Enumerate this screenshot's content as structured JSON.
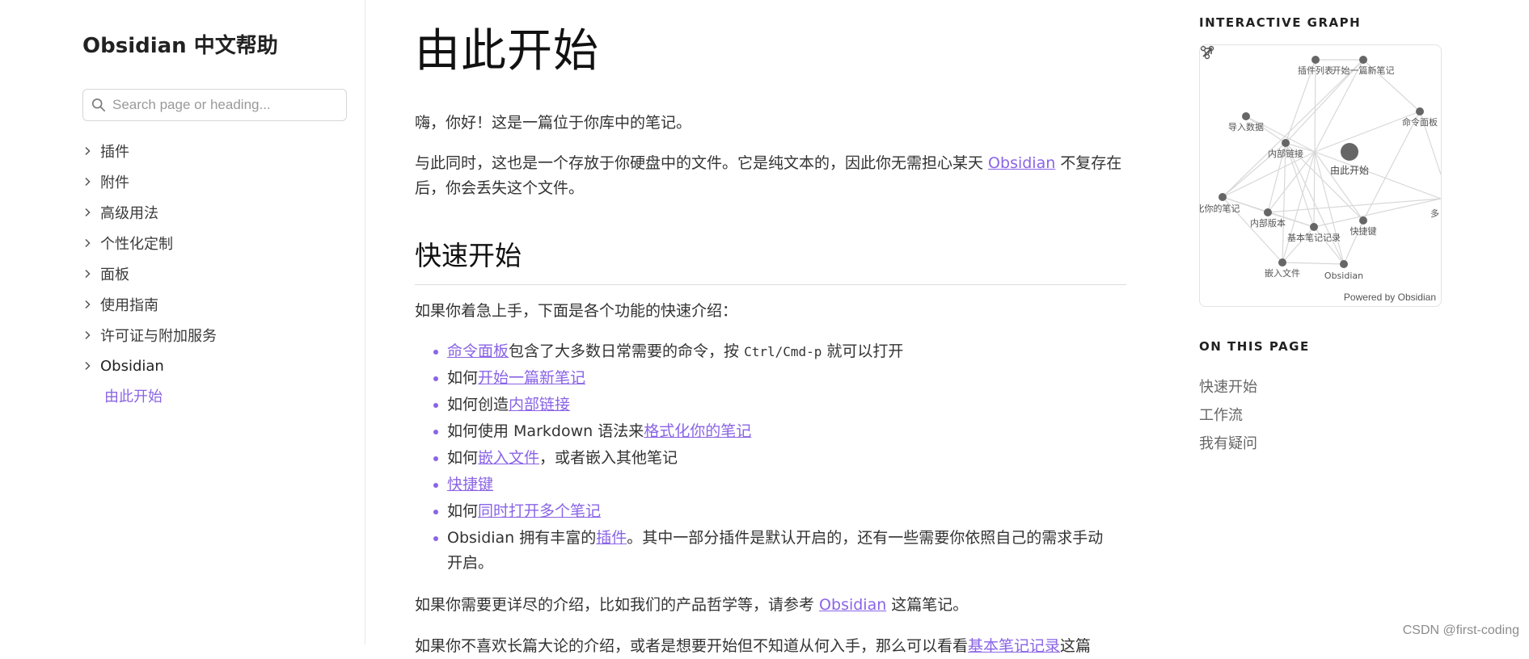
{
  "sidebar": {
    "title": "Obsidian 中文帮助",
    "search_placeholder": "Search page or heading...",
    "items": [
      {
        "label": "插件"
      },
      {
        "label": "附件"
      },
      {
        "label": "高级用法"
      },
      {
        "label": "个性化定制"
      },
      {
        "label": "面板"
      },
      {
        "label": "使用指南"
      },
      {
        "label": "许可证与附加服务"
      },
      {
        "label": "Obsidian"
      }
    ],
    "active_sub": "由此开始"
  },
  "main": {
    "title": "由此开始",
    "intro1": "嗨，你好！这是一篇位于你库中的笔记。",
    "intro2": {
      "before": "与此同时，这也是一个存放于你硬盘中的文件。它是纯文本的，因此你无需担心某天 ",
      "link": "Obsidian",
      "after": " 不复存在后，你会丢失这个文件。"
    },
    "quickstart_heading": "快速开始",
    "quickstart_intro": "如果你着急上手，下面是各个功能的快速介绍：",
    "list": [
      {
        "link": "命令面板",
        "text_after": "包含了大多数日常需要的命令，按 ",
        "code": "Ctrl/Cmd-p",
        "text_end": " 就可以打开"
      },
      {
        "before": "如何",
        "link": "开始一篇新笔记"
      },
      {
        "before": "如何创造",
        "link": "内部链接"
      },
      {
        "before": "如何使用 Markdown 语法来",
        "link": "格式化你的笔记"
      },
      {
        "before": "如何",
        "link": "嵌入文件",
        "after": "，或者嵌入其他笔记"
      },
      {
        "link": "快捷键"
      },
      {
        "before": "如何",
        "link": "同时打开多个笔记"
      },
      {
        "before": "Obsidian 拥有丰富的",
        "link": "插件",
        "after": "。其中一部分插件是默认开启的，还有一些需要你依照自己的需求手动开启。"
      }
    ],
    "more": {
      "before": "如果你需要更详尽的介绍，比如我们的产品哲学等，请参考 ",
      "link": "Obsidian",
      "after": " 这篇笔记。"
    },
    "cut_line": {
      "before": "如果你不喜欢长篇大论的介绍，或者是想要开始但不知道从何入手，那么可以看看",
      "link": "基本笔记记录",
      "after": "这篇"
    }
  },
  "graph": {
    "title": "INTERACTIVE GRAPH",
    "powered": "Powered by Obsidian",
    "nodes": [
      {
        "label": "插件列表"
      },
      {
        "label": "开始一篇新笔记"
      },
      {
        "label": "命令面板"
      },
      {
        "label": "导入数据"
      },
      {
        "label": "内部链接"
      },
      {
        "label": "由此开始"
      },
      {
        "label": "化你的笔记"
      },
      {
        "label": "内部版本"
      },
      {
        "label": "基本笔记记录"
      },
      {
        "label": "快捷键"
      },
      {
        "label": "多"
      },
      {
        "label": "嵌入文件"
      },
      {
        "label": "Obsidian"
      }
    ]
  },
  "toc": {
    "title": "ON THIS PAGE",
    "items": [
      "快速开始",
      "工作流",
      "我有疑问"
    ]
  },
  "watermark": "CSDN @first-coding",
  "colors": {
    "accent": "#8a64e6",
    "node": "#666666",
    "edge": "#d8d8d8"
  }
}
